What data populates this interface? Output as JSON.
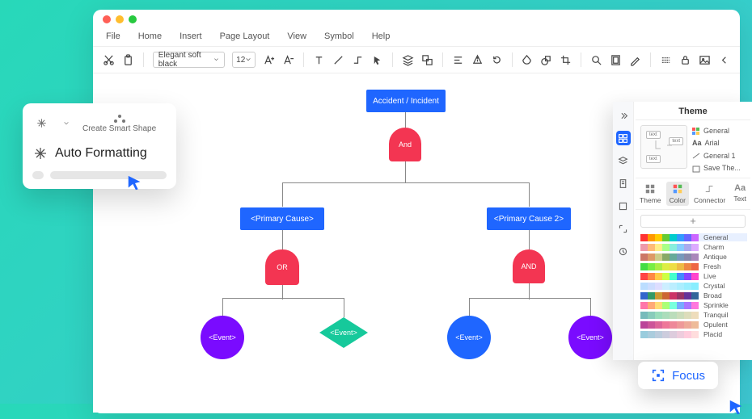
{
  "menus": {
    "file": "File",
    "home": "Home",
    "insert": "Insert",
    "pagelayout": "Page Layout",
    "view": "View",
    "symbol": "Symbol",
    "help": "Help"
  },
  "toolbar": {
    "font": "Elegant soft black",
    "size": "12"
  },
  "flow": {
    "root": "Accident / Incident",
    "and": "And",
    "pc1": "<Primary Cause>",
    "pc2": "<Primary Cause 2>",
    "or": "OR",
    "and2": "AND",
    "evt": "<Event>"
  },
  "autofmt": {
    "smart": "Create Smart Shape",
    "title": "Auto Formatting"
  },
  "theme": {
    "title": "Theme",
    "meta": {
      "general": "General",
      "font": "Arial",
      "gen1": "General 1",
      "save": "Save The..."
    },
    "tabs": {
      "theme": "Theme",
      "color": "Color",
      "connector": "Connector",
      "text": "Text"
    },
    "palettes": [
      "General",
      "Charm",
      "Antique",
      "Fresh",
      "Live",
      "Crystal",
      "Broad",
      "Sprinkle",
      "Tranquil",
      "Opulent",
      "Placid"
    ]
  },
  "focus": {
    "label": "Focus"
  },
  "palette_colors": [
    [
      "#f33",
      "#f90",
      "#fc0",
      "#6c3",
      "#0cc",
      "#39f",
      "#66f",
      "#c6f"
    ],
    [
      "#e9a",
      "#fb7",
      "#fe8",
      "#af8",
      "#8ed",
      "#8cf",
      "#aae",
      "#daf"
    ],
    [
      "#c76",
      "#d96",
      "#cc8",
      "#8a6",
      "#6a9",
      "#79b",
      "#88a",
      "#a8b"
    ],
    [
      "#4d4",
      "#7e4",
      "#ae4",
      "#de4",
      "#ed4",
      "#eb4",
      "#e84",
      "#e64"
    ],
    [
      "#f44",
      "#f84",
      "#fc4",
      "#cf4",
      "#4fc",
      "#48f",
      "#84f",
      "#f4c"
    ],
    [
      "#bdf",
      "#cdf",
      "#ddf",
      "#cef",
      "#bef",
      "#aef",
      "#9ef",
      "#8ef"
    ],
    [
      "#36c",
      "#396",
      "#c93",
      "#c63",
      "#c36",
      "#936",
      "#639",
      "#369"
    ],
    [
      "#f7a",
      "#fa7",
      "#fd7",
      "#af7",
      "#7fd",
      "#7af",
      "#a7f",
      "#f7d"
    ],
    [
      "#7bb",
      "#8cb",
      "#9db",
      "#adb",
      "#bdb",
      "#cdb",
      "#ddb",
      "#edb"
    ],
    [
      "#b49",
      "#c59",
      "#d69",
      "#e79",
      "#e89",
      "#e99",
      "#ea9",
      "#eb9"
    ],
    [
      "#9cd",
      "#acd",
      "#bcd",
      "#ccd",
      "#dcd",
      "#ecd",
      "#fcd",
      "#fdd"
    ]
  ]
}
